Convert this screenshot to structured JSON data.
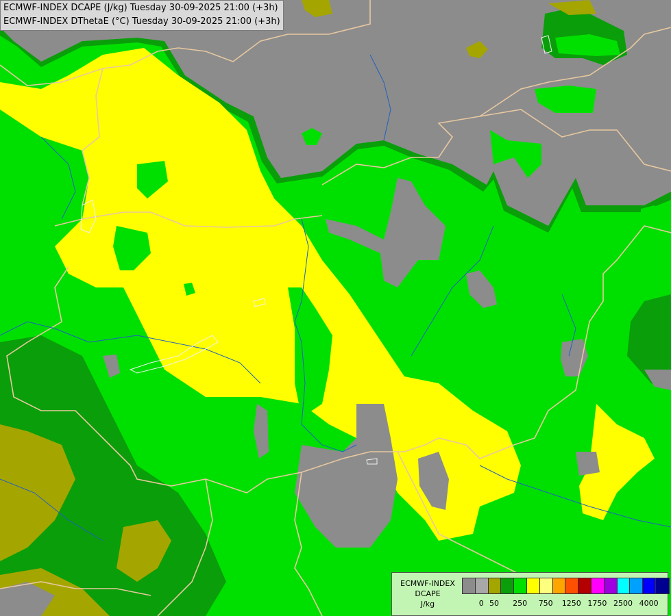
{
  "header": {
    "line1": "ECMWF-INDEX DCAPE (J/kg) Tuesday 30-09-2025 21:00 (+3h)",
    "line2": "ECMWF-INDEX DThetaE (°C) Tuesday 30-09-2025 21:00 (+3h)"
  },
  "legend": {
    "title_line1": "ECMWF-INDEX",
    "title_line2": "DCAPE",
    "unit": "J/kg",
    "colors": [
      "#8c8c8c",
      "#a8a8a8",
      "#a5a500",
      "#0a9e0a",
      "#00e000",
      "#ffff00",
      "#ffff7f",
      "#ffa500",
      "#ff5000",
      "#b40000",
      "#ff00ff",
      "#a000e0",
      "#00ffff",
      "#00a0ff",
      "#0000ff",
      "#000090"
    ],
    "tick_labels": [
      "0",
      "50",
      "250",
      "750",
      "1250",
      "1750",
      "2500",
      "4000"
    ]
  },
  "colors": {
    "no_data_gray": "#8c8c8c",
    "olive": "#a5a500",
    "dark_green": "#0a9e0a",
    "green": "#00e000",
    "yellow": "#ffff00",
    "border_line": "#e8c8a0",
    "river_line": "#2060c0"
  }
}
